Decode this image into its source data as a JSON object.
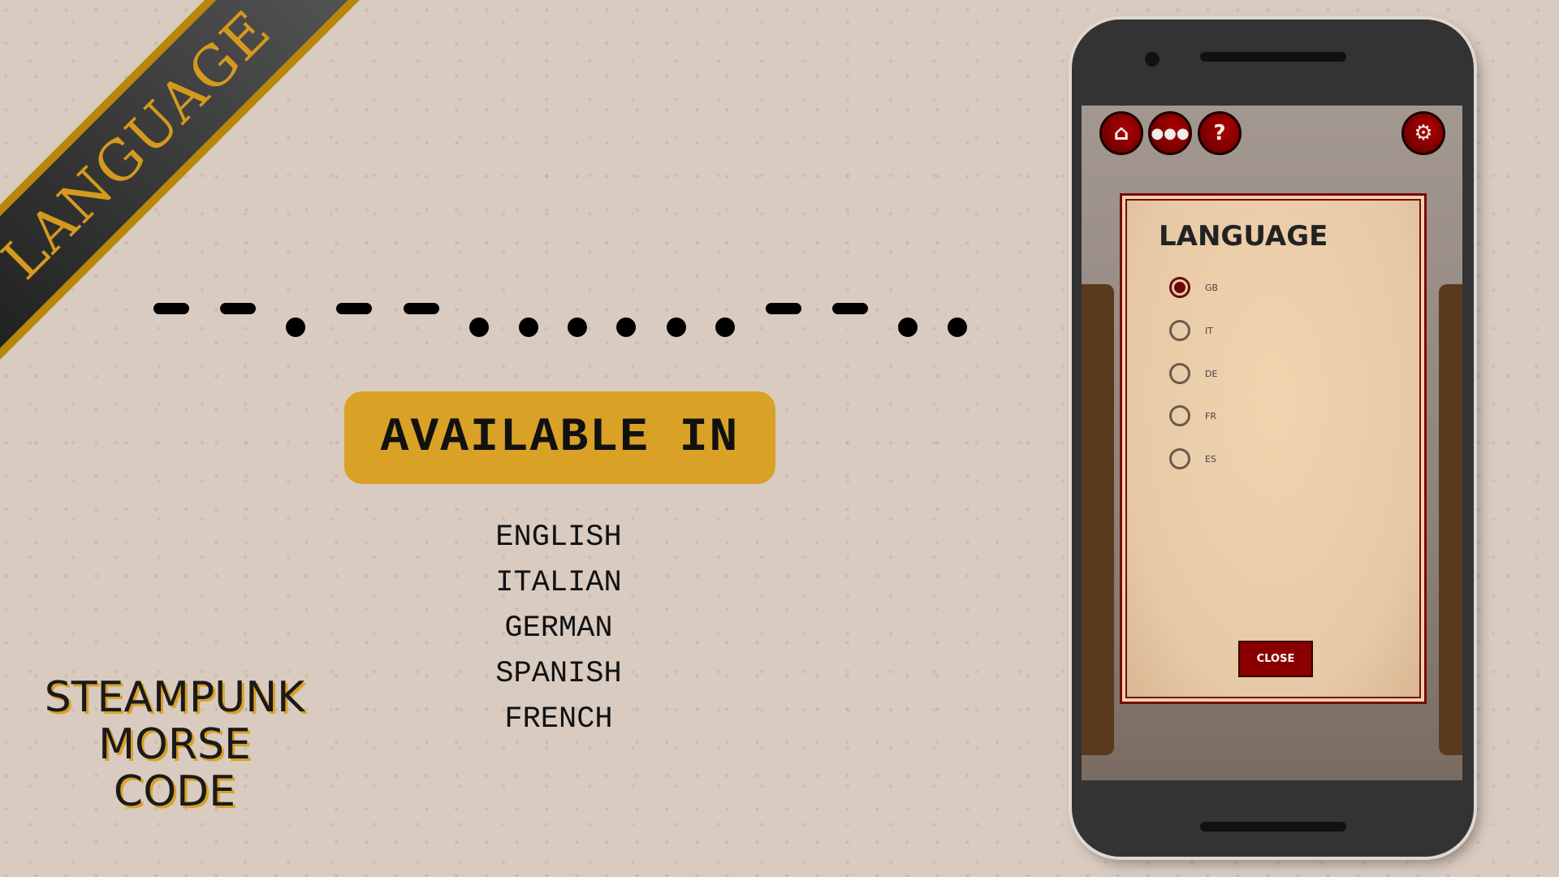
{
  "banner": {
    "label": "LANGUAGE"
  },
  "morse": [
    "dash",
    "dash",
    "dot",
    "dash",
    "dash",
    "dot",
    "dot",
    "dot",
    "dot",
    "dot",
    "dot",
    "dash",
    "dash",
    "dot",
    "dot"
  ],
  "available": {
    "label": "AVAILABLE IN",
    "languages": [
      "ENGLISH",
      "ITALIAN",
      "GERMAN",
      "SPANISH",
      "FRENCH"
    ]
  },
  "app_title": [
    "STEAMPUNK",
    "MORSE",
    "CODE"
  ],
  "phone": {
    "toolbar": {
      "icons": [
        "home-icon",
        "users-icon",
        "help-icon",
        "gear-icon"
      ]
    },
    "dialog": {
      "title": "LANGUAGE",
      "options": [
        {
          "code": "GB",
          "selected": true
        },
        {
          "code": "IT",
          "selected": false
        },
        {
          "code": "DE",
          "selected": false
        },
        {
          "code": "FR",
          "selected": false
        },
        {
          "code": "ES",
          "selected": false
        }
      ],
      "close_label": "CLOSE"
    }
  },
  "colors": {
    "gold": "#d9a126",
    "red": "#8a0000",
    "background": "#d9cbc0"
  }
}
